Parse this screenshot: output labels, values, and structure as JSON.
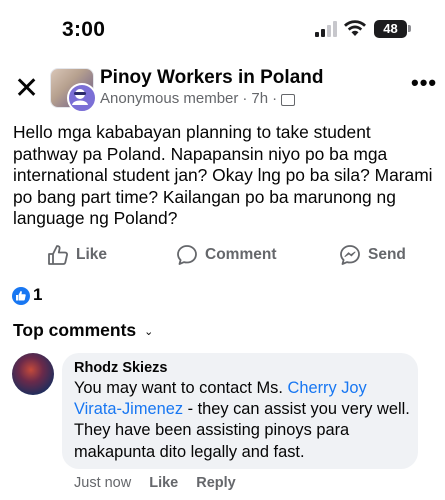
{
  "status_bar": {
    "time": "3:00",
    "battery": "48"
  },
  "post": {
    "group_name": "Pinoy Workers in Poland",
    "author": "Anonymous member",
    "time": "7h",
    "body": "Hello mga kababayan planning to take student pathway pa Poland. Napapansin niyo po ba mga international student jan? Okay lng po ba sila? Marami po bang part time? Kailangan po ba marunong ng language ng Poland?"
  },
  "actions": {
    "like": "Like",
    "comment": "Comment",
    "send": "Send"
  },
  "reactions": {
    "count": "1"
  },
  "comments_section": {
    "title": "Top comments"
  },
  "comment": {
    "author": "Rhodz Skiezs",
    "text_before": "You may want to contact Ms. ",
    "mention": "Cherry Joy Virata-Jimenez",
    "text_after": " - they can assist you very well. They have been assisting pinoys para makapunta dito legally and fast.",
    "time": "Just now",
    "like": "Like",
    "reply": "Reply"
  },
  "colors": {
    "accent": "#1877f2",
    "secondary_text": "#65676b",
    "bubble": "#f0f2f5"
  }
}
